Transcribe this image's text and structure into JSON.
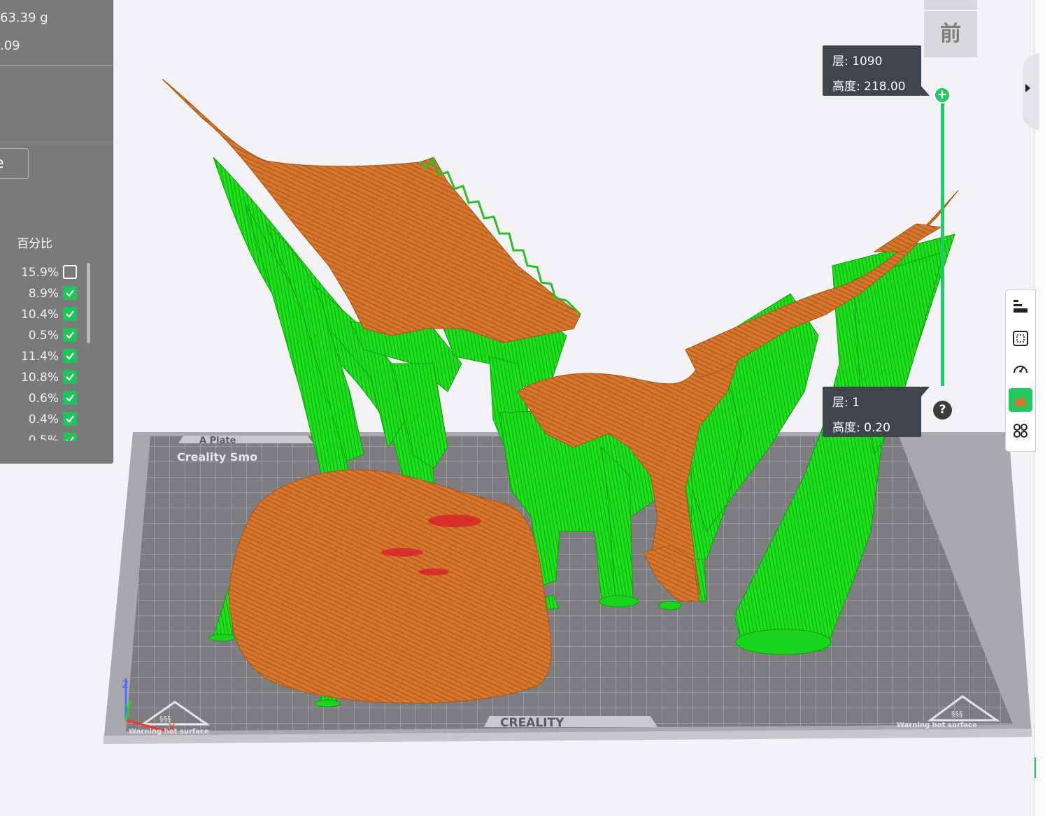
{
  "stats": {
    "weight": "63.39 g",
    "cost": ".09"
  },
  "panel": {
    "button_label": "e",
    "percent_title": "百分比",
    "items": [
      {
        "percent": "15.9%",
        "checked": false
      },
      {
        "percent": "8.9%",
        "checked": true
      },
      {
        "percent": "10.4%",
        "checked": true
      },
      {
        "percent": "0.5%",
        "checked": true
      },
      {
        "percent": "11.4%",
        "checked": true
      },
      {
        "percent": "10.8%",
        "checked": true
      },
      {
        "percent": "0.6%",
        "checked": true
      },
      {
        "percent": "0.4%",
        "checked": true
      },
      {
        "percent": "0.5%",
        "checked": true
      }
    ]
  },
  "view": {
    "front_label": "前"
  },
  "layer_slider": {
    "top": {
      "layer": "层: 1090",
      "height": "高度: 218.00"
    },
    "bottom": {
      "layer": "层: 1",
      "height": "高度: 0.20"
    },
    "handle_symbol": "+",
    "help_symbol": "?"
  },
  "plate": {
    "name": "A Plate",
    "brand_top": "Creality Smo",
    "brand_bottom": "CREALITY",
    "warning_left": "Warning hot surface",
    "warning_right": "Warning hot surface"
  },
  "toolbar": {
    "icons": [
      "layer-list-icon",
      "bounding-box-icon",
      "speed-gauge-icon",
      "model-color-icon",
      "apps-icon"
    ],
    "active_index": 3
  },
  "colors": {
    "support": "#19e01a",
    "model": "#d9772e",
    "accent": "#1fcb62",
    "bed": "#7c7c7f"
  }
}
